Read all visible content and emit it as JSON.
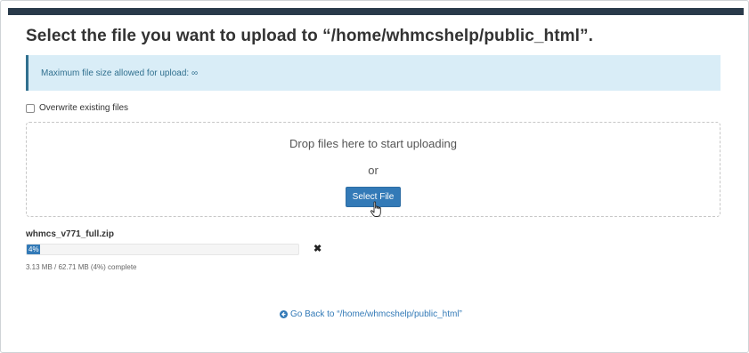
{
  "page": {
    "title": "Select the file you want to upload to “/home/whmcshelp/public_html”."
  },
  "info": {
    "text": "Maximum file size allowed for upload: ∞"
  },
  "overwrite": {
    "label": "Overwrite existing files",
    "checked": false
  },
  "dropzone": {
    "primary_text": "Drop files here to start uploading",
    "or_text": "or",
    "button_label": "Select File"
  },
  "upload": {
    "file_name": "whmcs_v771_full.zip",
    "progress_label": "4%",
    "progress_percent": 4,
    "status_text": "3.13 MB / 62.71 MB (4%) complete",
    "cancel_icon": "close-icon"
  },
  "footer": {
    "go_back_text": "Go Back to “/home/whmcshelp/public_html”",
    "go_back_icon": "arrow-circle-left-icon"
  },
  "colors": {
    "topbar": "#293a4a",
    "accent": "#337ab7",
    "info_bg": "#d9edf7",
    "info_text": "#31708f"
  }
}
